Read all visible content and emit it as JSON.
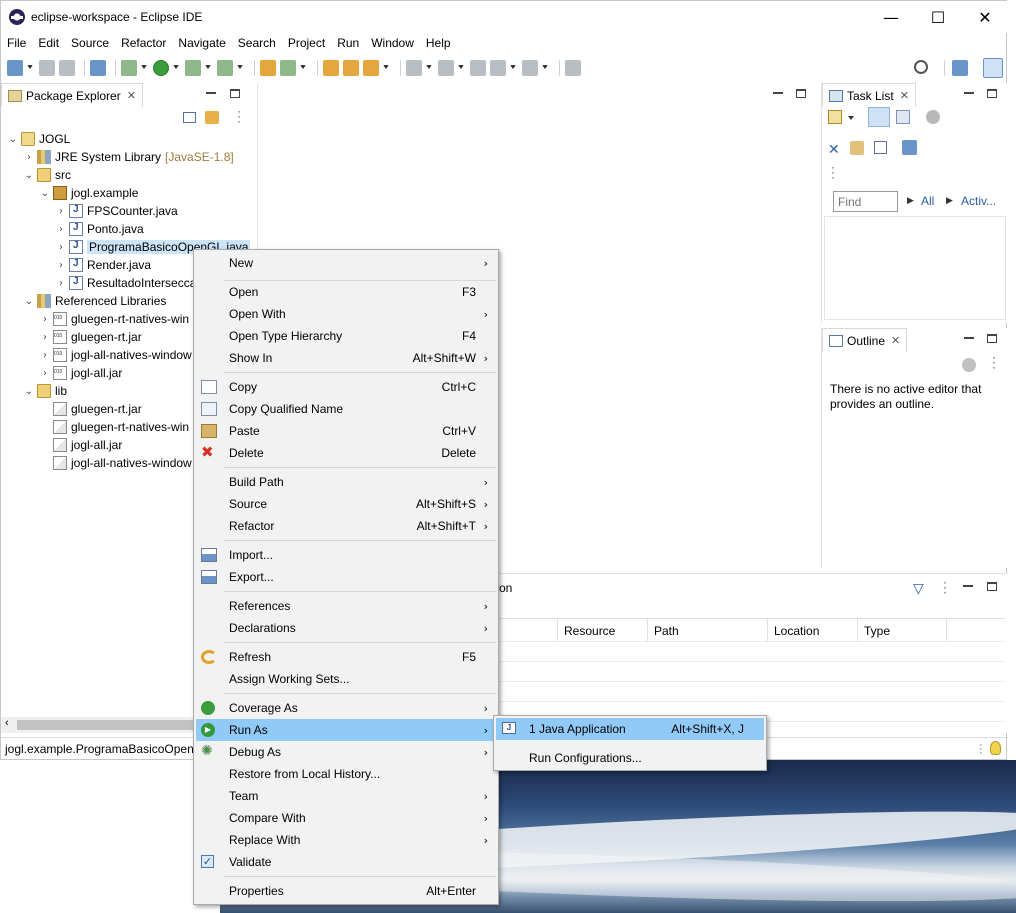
{
  "window": {
    "title": "eclipse-workspace - Eclipse IDE",
    "controls": {
      "minimize": "—",
      "maximize": "☐",
      "close": "✕"
    }
  },
  "menubar": [
    "File",
    "Edit",
    "Source",
    "Refactor",
    "Navigate",
    "Search",
    "Project",
    "Run",
    "Window",
    "Help"
  ],
  "package_explorer": {
    "tab_label": "Package Explorer",
    "tree": [
      {
        "label": "JOGL",
        "icon": "project-icon",
        "expander": "⌄"
      },
      {
        "label": "JRE System Library",
        "hint": "[JavaSE-1.8]",
        "icon": "library-icon",
        "expander": "›"
      },
      {
        "label": "src",
        "icon": "folder-icon",
        "expander": "⌄"
      },
      {
        "label": "jogl.example",
        "icon": "package-icon",
        "expander": "⌄"
      },
      {
        "label": "FPSCounter.java",
        "icon": "java-file-icon",
        "expander": "›"
      },
      {
        "label": "Ponto.java",
        "icon": "java-file-icon",
        "expander": "›"
      },
      {
        "label": "ProgramaBasicoOpenGL.java",
        "icon": "java-file-icon",
        "expander": "›"
      },
      {
        "label": "Render.java",
        "icon": "java-file-icon",
        "expander": "›"
      },
      {
        "label": "ResultadoIntersecca",
        "icon": "java-file-icon",
        "expander": "›"
      },
      {
        "label": "Referenced Libraries",
        "icon": "library-icon",
        "expander": "⌄"
      },
      {
        "label": "gluegen-rt-natives-win",
        "icon": "jar-icon",
        "expander": "›"
      },
      {
        "label": "gluegen-rt.jar",
        "icon": "jar-icon",
        "expander": "›"
      },
      {
        "label": "jogl-all-natives-window",
        "icon": "jar-icon",
        "expander": "›"
      },
      {
        "label": "jogl-all.jar",
        "icon": "jar-icon",
        "expander": "›"
      },
      {
        "label": "lib",
        "icon": "folder-icon",
        "expander": "⌄"
      },
      {
        "label": "gluegen-rt.jar",
        "icon": "jar-file-icon",
        "expander": ""
      },
      {
        "label": "gluegen-rt-natives-win",
        "icon": "jar-file-icon",
        "expander": ""
      },
      {
        "label": "jogl-all.jar",
        "icon": "jar-file-icon",
        "expander": ""
      },
      {
        "label": "jogl-all-natives-window",
        "icon": "jar-file-icon",
        "expander": ""
      }
    ]
  },
  "task_list": {
    "tab_label": "Task List",
    "find_placeholder": "Find",
    "filter_all": "All",
    "filter_active": "Activ..."
  },
  "outline": {
    "tab_label": "Outline",
    "message": "There is no active editor that provides an outline."
  },
  "problems_view": {
    "partial_tab": "on",
    "columns": [
      "Resource",
      "Path",
      "Location",
      "Type"
    ]
  },
  "statusbar": {
    "text": "jogl.example.ProgramaBasicoOpenG"
  },
  "context_menu": {
    "items": [
      {
        "label": "New",
        "accel": "",
        "submenu": true,
        "icon": ""
      },
      {
        "sep": true
      },
      {
        "label": "Open",
        "accel": "F3",
        "submenu": false,
        "icon": ""
      },
      {
        "label": "Open With",
        "accel": "",
        "submenu": true,
        "icon": ""
      },
      {
        "label": "Open Type Hierarchy",
        "accel": "F4",
        "submenu": false,
        "icon": ""
      },
      {
        "label": "Show In",
        "accel": "Alt+Shift+W",
        "submenu": true,
        "icon": ""
      },
      {
        "sep": true
      },
      {
        "label": "Copy",
        "accel": "Ctrl+C",
        "submenu": false,
        "icon": "copy-icon"
      },
      {
        "label": "Copy Qualified Name",
        "accel": "",
        "submenu": false,
        "icon": "copy-qualified-icon"
      },
      {
        "label": "Paste",
        "accel": "Ctrl+V",
        "submenu": false,
        "icon": "paste-icon"
      },
      {
        "label": "Delete",
        "accel": "Delete",
        "submenu": false,
        "icon": "delete-icon"
      },
      {
        "sep": true
      },
      {
        "label": "Build Path",
        "accel": "",
        "submenu": true,
        "icon": ""
      },
      {
        "label": "Source",
        "accel": "Alt+Shift+S",
        "submenu": true,
        "icon": ""
      },
      {
        "label": "Refactor",
        "accel": "Alt+Shift+T",
        "submenu": true,
        "icon": ""
      },
      {
        "sep": true
      },
      {
        "label": "Import...",
        "accel": "",
        "submenu": false,
        "icon": "import-icon"
      },
      {
        "label": "Export...",
        "accel": "",
        "submenu": false,
        "icon": "export-icon"
      },
      {
        "sep": true
      },
      {
        "label": "References",
        "accel": "",
        "submenu": true,
        "icon": ""
      },
      {
        "label": "Declarations",
        "accel": "",
        "submenu": true,
        "icon": ""
      },
      {
        "sep": true
      },
      {
        "label": "Refresh",
        "accel": "F5",
        "submenu": false,
        "icon": "refresh-icon"
      },
      {
        "label": "Assign Working Sets...",
        "accel": "",
        "submenu": false,
        "icon": ""
      },
      {
        "sep": true
      },
      {
        "label": "Coverage As",
        "accel": "",
        "submenu": true,
        "icon": "coverage-icon"
      },
      {
        "label": "Run As",
        "accel": "",
        "submenu": true,
        "icon": "run-icon",
        "highlight": true
      },
      {
        "label": "Debug As",
        "accel": "",
        "submenu": true,
        "icon": "debug-icon"
      },
      {
        "label": "Restore from Local History...",
        "accel": "",
        "submenu": false,
        "icon": ""
      },
      {
        "label": "Team",
        "accel": "",
        "submenu": true,
        "icon": ""
      },
      {
        "label": "Compare With",
        "accel": "",
        "submenu": true,
        "icon": ""
      },
      {
        "label": "Replace With",
        "accel": "",
        "submenu": true,
        "icon": ""
      },
      {
        "label": "Validate",
        "accel": "",
        "submenu": false,
        "icon": "validate-check-icon"
      },
      {
        "sep": true
      },
      {
        "label": "Properties",
        "accel": "Alt+Enter",
        "submenu": false,
        "icon": ""
      }
    ]
  },
  "run_as_submenu": {
    "items": [
      {
        "label": "1 Java Application",
        "accel": "Alt+Shift+X, J",
        "highlight": true,
        "icon": "java-app-icon"
      },
      {
        "label": "Run Configurations...",
        "accel": "",
        "highlight": false,
        "icon": ""
      }
    ]
  },
  "colors": {
    "menu_highlight": "#91c9f7",
    "tree_selection": "#cce4f7",
    "menu_bg": "#f2f2f2"
  }
}
